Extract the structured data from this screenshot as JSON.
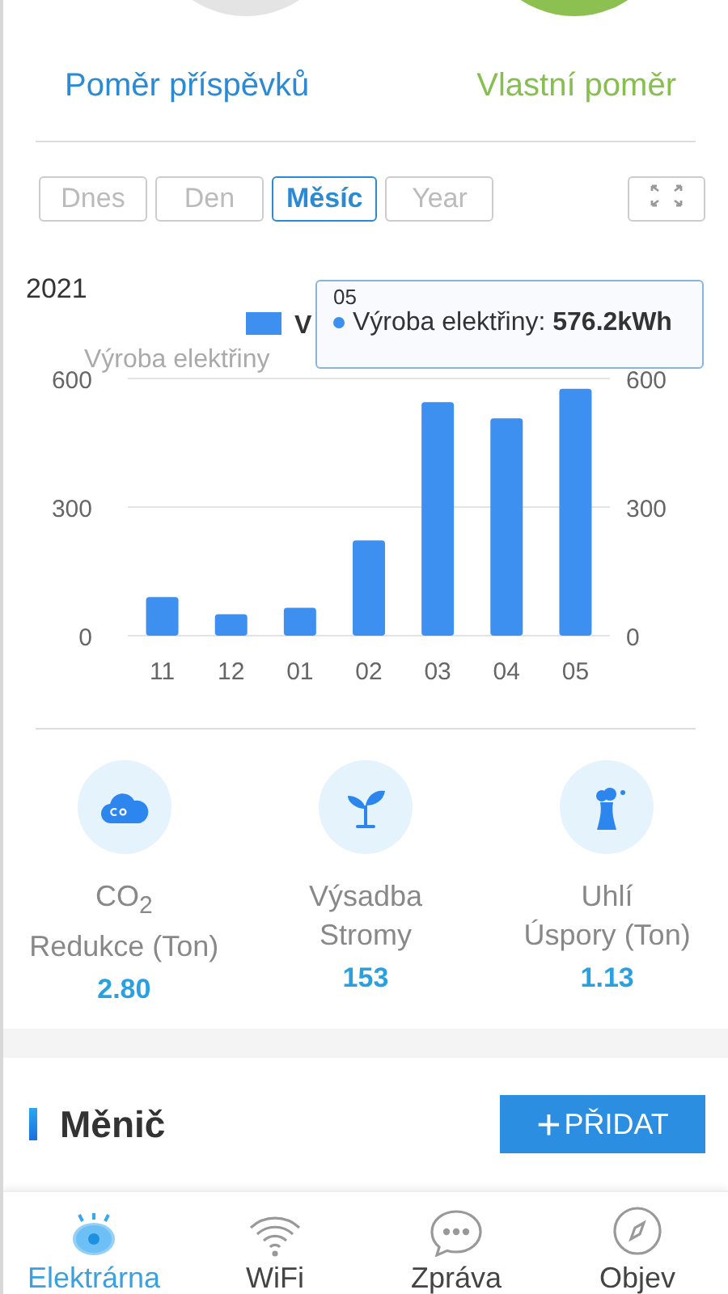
{
  "header": {
    "left_label": "Poměr příspěvků",
    "right_label": "Vlastní poměr"
  },
  "periods": [
    {
      "label": "Dnes",
      "selected": false
    },
    {
      "label": "Den",
      "selected": false
    },
    {
      "label": "Měsíc",
      "selected": true
    },
    {
      "label": "Year",
      "selected": false
    }
  ],
  "chart": {
    "year": "2021",
    "legend": [
      {
        "name": "V",
        "kind": "bar"
      }
    ],
    "left_axis_name": "Výroba elektřiny",
    "right_ticks": [
      "600",
      "300",
      "0"
    ],
    "tooltip": {
      "title": "05",
      "separator": ":",
      "value": "576.2kWh"
    },
    "chart_data": {
      "type": "bar",
      "categories": [
        "11",
        "12",
        "01",
        "02",
        "03",
        "04",
        "05"
      ],
      "series": [
        {
          "name": "Výroba elektřiny",
          "color": "#3d8ff0",
          "values": [
            90,
            50,
            65,
            222,
            545,
            507,
            576
          ]
        }
      ],
      "ylim": [
        0,
        600
      ],
      "yticks": [
        {
          "value": 0,
          "label": "0"
        },
        {
          "value": 300,
          "label": "300"
        },
        {
          "value": 600,
          "label": "600"
        }
      ]
    }
  },
  "stats": [
    {
      "kind": "co2",
      "label": "CO$_{2}$\nRedukce (Ton)",
      "value": "2.80"
    },
    {
      "kind": "tree",
      "label": "Výsadba\nStromy",
      "value": "153"
    },
    {
      "kind": "coal",
      "label": "Uhlí\nÚspory (Ton)",
      "value": "1.13"
    }
  ],
  "section": {
    "title": "Měnič",
    "add_symbol": "+",
    "button": "PŘIDAT"
  },
  "nav": [
    {
      "kind": "eye",
      "label": "Elektrárna",
      "selected": true
    },
    {
      "kind": "wifi",
      "label": "WiFi",
      "selected": false
    },
    {
      "kind": "chat",
      "label": "Zpráva",
      "selected": false
    },
    {
      "kind": "compass",
      "label": "Objev",
      "selected": false
    }
  ]
}
